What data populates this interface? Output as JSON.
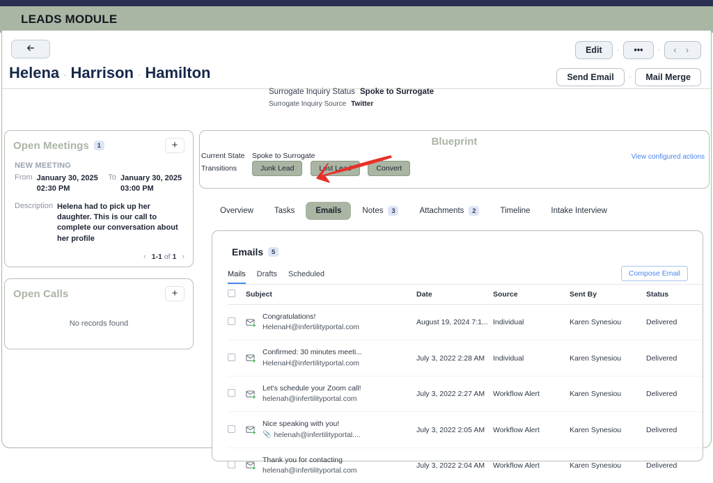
{
  "module": {
    "title": "LEADS MODULE"
  },
  "record": {
    "back_icon": "arrow-left-icon",
    "first_name": "Helena",
    "middle_name": "Harrison",
    "last_name": "Hamilton",
    "separator": "·",
    "status_label": "Surrogate Inquiry Status",
    "status_value": "Spoke to Surrogate",
    "source_label": "Surrogate Inquiry Source",
    "source_value": "Twitter"
  },
  "header_actions": {
    "edit": "Edit",
    "more": "•••",
    "prev_next": "‹  ›",
    "send_email": "Send Email",
    "mail_merge": "Mail Merge",
    "dot": "·"
  },
  "open_meetings": {
    "title": "Open Meetings",
    "count": "1",
    "add": "+",
    "section_label": "NEW MEETING",
    "from_label": "From",
    "from_value": "January 30, 2025 02:30 PM",
    "to_label": "To",
    "to_value": "January 30, 2025 03:00 PM",
    "description_label": "Description",
    "description_value": "Helena had to pick up her daughter.  This is our call to complete our conversation about her profile",
    "pager": {
      "prev": "‹",
      "range": "1-1",
      "of": "of",
      "total": "1",
      "next": "›"
    }
  },
  "open_calls": {
    "title": "Open Calls",
    "add": "+",
    "empty": "No records found"
  },
  "blueprint": {
    "title": "Blueprint",
    "current_state_label": "Current State",
    "current_state_value": "Spoke to Surrogate",
    "transitions_label": "Transitions",
    "transitions": [
      "Junk Lead",
      "Lost Lead",
      "Convert"
    ],
    "view_actions_link": "View configured actions"
  },
  "tabs": [
    {
      "label": "Overview",
      "count": null,
      "active": false
    },
    {
      "label": "Tasks",
      "count": null,
      "active": false
    },
    {
      "label": "Emails",
      "count": null,
      "active": true
    },
    {
      "label": "Notes",
      "count": "3",
      "active": false
    },
    {
      "label": "Attachments",
      "count": "2",
      "active": false
    },
    {
      "label": "Timeline",
      "count": null,
      "active": false
    },
    {
      "label": "Intake Interview",
      "count": null,
      "active": false
    }
  ],
  "emails": {
    "title": "Emails",
    "count": "5",
    "compose_label": "Compose Email",
    "sub_tabs": [
      {
        "label": "Mails",
        "active": true
      },
      {
        "label": "Drafts",
        "active": false
      },
      {
        "label": "Scheduled",
        "active": false
      }
    ],
    "columns": [
      "Subject",
      "Date",
      "Source",
      "Sent By",
      "Status"
    ],
    "rows": [
      {
        "subject": "Congratulations!",
        "address": "HelenaH@infertilityportal.com",
        "has_attachment": false,
        "date": "August 19, 2024 7:1...",
        "source": "Individual",
        "sent_by": "Karen Synesiou",
        "status": "Delivered"
      },
      {
        "subject": "Confirmed: 30 minutes meeti...",
        "address": "HelenaH@infertilityportal.com",
        "has_attachment": false,
        "date": "July 3, 2022 2:28 AM",
        "source": "Individual",
        "sent_by": "Karen Synesiou",
        "status": "Delivered"
      },
      {
        "subject": "Let's schedule your Zoom call!",
        "address": "helenah@infertilityportal.com",
        "has_attachment": false,
        "date": "July 3, 2022 2:27 AM",
        "source": "Workflow Alert",
        "sent_by": "Karen Synesiou",
        "status": "Delivered"
      },
      {
        "subject": "Nice speaking with you!",
        "address": "helenah@infertilityportal....",
        "has_attachment": true,
        "date": "July 3, 2022 2:05 AM",
        "source": "Workflow Alert",
        "sent_by": "Karen Synesiou",
        "status": "Delivered"
      },
      {
        "subject": "Thank you for contacting",
        "address": "helenah@infertilityportal.com",
        "has_attachment": false,
        "date": "July 3, 2022 2:04 AM",
        "source": "Workflow Alert",
        "sent_by": "Karen Synesiou",
        "status": "Delivered"
      }
    ]
  },
  "colors": {
    "top_strip": "#2b3050",
    "module_bar": "#aab6a4",
    "sage_border": "#b7c1b2",
    "accent_link": "#4a86f0",
    "badge_bg": "#dde5f6",
    "annotation_red": "#e8302a",
    "name_navy": "#16284a"
  },
  "annotation": {
    "shape": "red-arrow",
    "points_to": "Emails"
  }
}
